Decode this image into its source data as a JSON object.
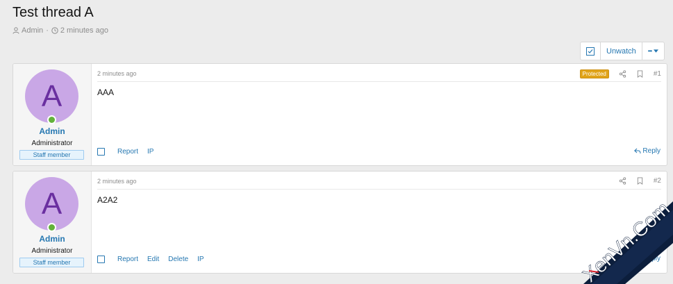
{
  "thread": {
    "title": "Test thread A",
    "author": "Admin",
    "time": "2 minutes ago"
  },
  "actions": {
    "watch_label": "Unwatch",
    "more_label": "•••"
  },
  "posts": [
    {
      "avatar_letter": "A",
      "username": "Admin",
      "user_title": "Administrator",
      "banner": "Staff member",
      "time": "2 minutes ago",
      "badge": "Protected",
      "number": "#1",
      "content": "AAA",
      "footer_links": [
        "Report",
        "IP"
      ],
      "reply_label": "Reply"
    },
    {
      "avatar_letter": "A",
      "username": "Admin",
      "user_title": "Administrator",
      "banner": "Staff member",
      "time": "2 minutes ago",
      "number": "#2",
      "content": "A2A2",
      "footer_links": [
        "Report",
        "Edit",
        "Delete",
        "IP"
      ],
      "reply_label": "Reply"
    }
  ],
  "watermark": "XenVn.Com",
  "colors": {
    "link": "#2577b1",
    "avatar_bg": "#c9a7e6",
    "avatar_letter": "#6a2fa0",
    "protected": "#e0a318",
    "online": "#63b23b"
  }
}
